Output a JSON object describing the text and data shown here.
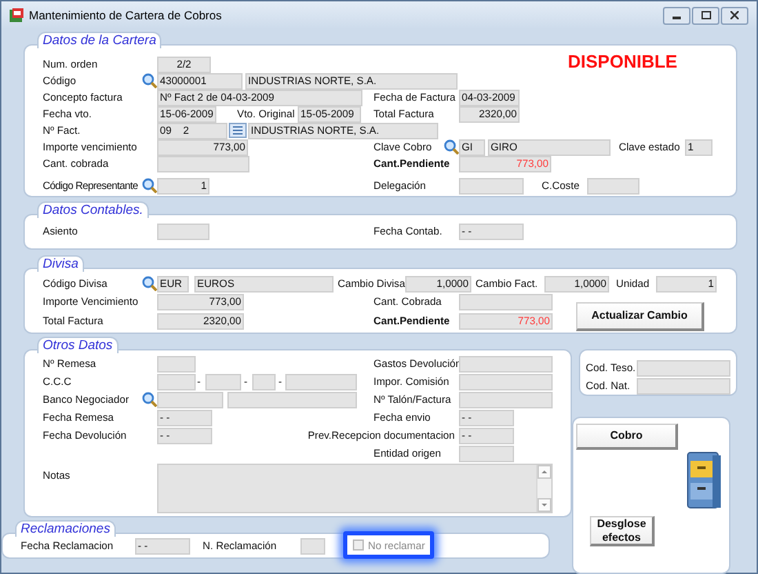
{
  "window": {
    "title": "Mantenimiento de Cartera de Cobros"
  },
  "panels": [
    {
      "title": "Datos de la Cartera",
      "lines": [
        {
          "items": [
            {
              "kind": "label",
              "text": "Num. orden"
            },
            {
              "kind": "field",
              "value": "2/2"
            },
            {
              "kind": "banner",
              "text": "DISPONIBLE"
            }
          ]
        },
        {
          "items": [
            {
              "kind": "label",
              "text": "Código"
            },
            {
              "kind": "field",
              "value": "43000001"
            },
            {
              "kind": "field",
              "value": "INDUSTRIAS NORTE, S.A."
            }
          ]
        },
        {
          "items": [
            {
              "kind": "label",
              "text": "Concepto factura"
            },
            {
              "kind": "field",
              "value": "Nº Fact 2 de 04-03-2009"
            },
            {
              "kind": "label",
              "text": "Fecha de Factura"
            },
            {
              "kind": "field",
              "value": "04-03-2009"
            }
          ]
        },
        {
          "items": [
            {
              "kind": "label",
              "text": "Fecha vto."
            },
            {
              "kind": "field",
              "value": "15-06-2009"
            },
            {
              "kind": "label",
              "text": "Vto. Original"
            },
            {
              "kind": "field",
              "value": "15-05-2009"
            },
            {
              "kind": "label",
              "text": "Total Factura"
            },
            {
              "kind": "field",
              "value": "2320,00"
            }
          ]
        },
        {
          "items": [
            {
              "kind": "label",
              "text": "Nº Fact."
            },
            {
              "kind": "field",
              "value": "09    2"
            },
            {
              "kind": "field",
              "value": "INDUSTRIAS NORTE, S.A."
            }
          ]
        },
        {
          "items": [
            {
              "kind": "label",
              "text": "Importe vencimiento"
            },
            {
              "kind": "field",
              "value": "773,00"
            },
            {
              "kind": "label",
              "text": "Clave Cobro"
            },
            {
              "kind": "field",
              "value": "GI"
            },
            {
              "kind": "field",
              "value": "GIRO"
            },
            {
              "kind": "label",
              "text": "Clave estado"
            },
            {
              "kind": "field",
              "value": "1"
            }
          ]
        },
        {
          "items": [
            {
              "kind": "label",
              "text": "Cant. cobrada"
            },
            {
              "kind": "field"
            },
            {
              "kind": "strong_label",
              "text": "Cant.Pendiente"
            },
            {
              "kind": "alert_field",
              "value": "773,00"
            }
          ]
        },
        {
          "items": [
            {
              "kind": "label",
              "text": "Código Representante"
            },
            {
              "kind": "field",
              "value": "1"
            },
            {
              "kind": "label",
              "text": "Delegación"
            },
            {
              "kind": "field"
            },
            {
              "kind": "label",
              "text": "C.Coste"
            },
            {
              "kind": "field"
            }
          ]
        }
      ]
    },
    {
      "title": "Datos Contables.",
      "lines": [
        {
          "items": [
            {
              "kind": "label",
              "text": "Asiento"
            },
            {
              "kind": "field"
            },
            {
              "kind": "label",
              "text": "Fecha Contab."
            },
            {
              "kind": "field",
              "value": "- -"
            }
          ]
        }
      ]
    },
    {
      "title": "Divisa",
      "lines": [
        {
          "items": [
            {
              "kind": "label",
              "text": "Código Divisa"
            },
            {
              "kind": "field",
              "value": "EUR"
            },
            {
              "kind": "field",
              "value": "EUROS"
            },
            {
              "kind": "label",
              "text": "Cambio Divisa"
            },
            {
              "kind": "field",
              "value": "1,0000"
            },
            {
              "kind": "label",
              "text": "Cambio Fact."
            },
            {
              "kind": "field",
              "value": "1,0000"
            },
            {
              "kind": "label",
              "text": "Unidad"
            },
            {
              "kind": "field",
              "value": "1"
            }
          ]
        },
        {
          "items": [
            {
              "kind": "label",
              "text": "Importe Vencimiento"
            },
            {
              "kind": "field",
              "value": "773,00"
            },
            {
              "kind": "label",
              "text": "Cant. Cobrada"
            },
            {
              "kind": "field"
            },
            {
              "kind": "button",
              "text": "Actualizar Cambio"
            }
          ]
        },
        {
          "items": [
            {
              "kind": "label",
              "text": "Total Factura"
            },
            {
              "kind": "field",
              "value": "2320,00"
            },
            {
              "kind": "strong_label",
              "text": "Cant.Pendiente"
            },
            {
              "kind": "alert_field",
              "value": "773,00"
            }
          ]
        }
      ]
    },
    {
      "title": "Otros Datos",
      "lines": [
        {
          "items": [
            {
              "kind": "label",
              "text": "Nº Remesa"
            },
            {
              "kind": "field"
            },
            {
              "kind": "label",
              "text": "Gastos Devolución"
            },
            {
              "kind": "field"
            }
          ]
        },
        {
          "items": [
            {
              "kind": "label",
              "text": "C.C.C"
            },
            {
              "kind": "field"
            },
            {
              "kind": "separator",
              "text": "-"
            },
            {
              "kind": "field"
            },
            {
              "kind": "separator",
              "text": "-"
            },
            {
              "kind": "field"
            },
            {
              "kind": "separator",
              "text": "-"
            },
            {
              "kind": "field"
            },
            {
              "kind": "label",
              "text": "Impor. Comisión"
            },
            {
              "kind": "field"
            }
          ]
        },
        {
          "items": [
            {
              "kind": "label",
              "text": "Banco Negociador"
            },
            {
              "kind": "field"
            },
            {
              "kind": "field"
            },
            {
              "kind": "label",
              "text": "Nº Talón/Factura"
            },
            {
              "kind": "field"
            }
          ]
        },
        {
          "items": [
            {
              "kind": "label",
              "text": "Fecha Remesa"
            },
            {
              "kind": "field",
              "value": "- -"
            },
            {
              "kind": "label",
              "text": "Fecha envio"
            },
            {
              "kind": "field",
              "value": "- -"
            }
          ]
        },
        {
          "items": [
            {
              "kind": "label",
              "text": "Fecha Devolución"
            },
            {
              "kind": "field",
              "value": "- -"
            },
            {
              "kind": "label",
              "text": "Prev.Recepcion documentacion"
            },
            {
              "kind": "field",
              "value": "- -"
            }
          ]
        },
        {
          "items": [
            {
              "kind": "label",
              "text": "Entidad origen"
            },
            {
              "kind": "field"
            }
          ]
        },
        {
          "items": [
            {
              "kind": "label",
              "text": "Notas"
            },
            {
              "kind": "textarea"
            }
          ]
        }
      ]
    },
    {
      "lines": [
        {
          "items": [
            {
              "kind": "label",
              "text": "Cod. Teso."
            },
            {
              "kind": "field"
            }
          ]
        },
        {
          "items": [
            {
              "kind": "label",
              "text": "Cod. Nat."
            },
            {
              "kind": "field"
            }
          ]
        }
      ]
    },
    {
      "lines": [
        {
          "items": [
            {
              "kind": "button",
              "text": "Cobro"
            }
          ]
        },
        {
          "items": [
            {
              "kind": "button",
              "text": "Desglose efectos"
            }
          ]
        }
      ]
    },
    {
      "title": "Reclamaciones",
      "lines": [
        {
          "items": [
            {
              "kind": "label",
              "text": "Fecha Reclamacion"
            },
            {
              "kind": "field",
              "value": "- -"
            },
            {
              "kind": "label",
              "text": "N. Reclamación"
            },
            {
              "kind": "field"
            },
            {
              "kind": "checkbox",
              "text": "No reclamar",
              "checked": false,
              "disabled": true,
              "focused": true
            }
          ]
        }
      ]
    }
  ]
}
